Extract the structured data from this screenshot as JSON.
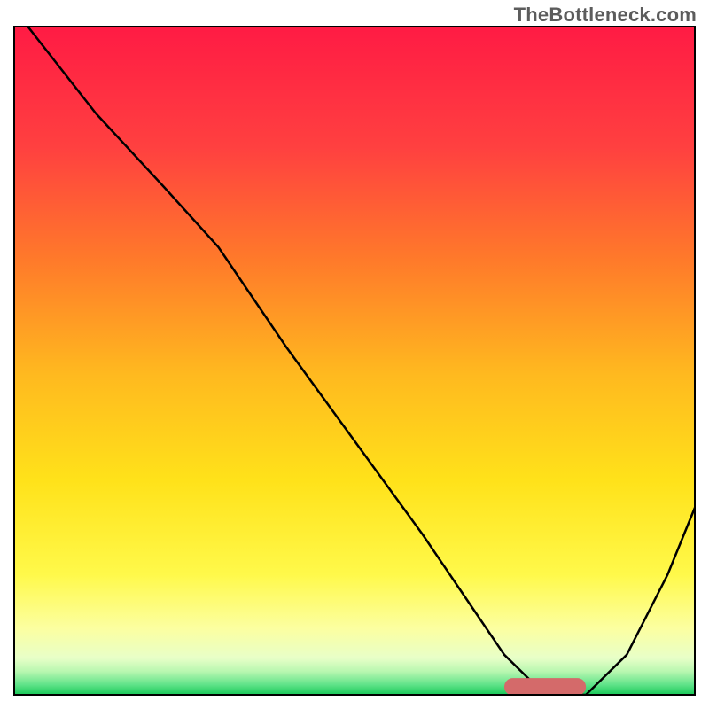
{
  "watermark": "TheBottleneck.com",
  "chart_data": {
    "type": "line",
    "title": "",
    "xlabel": "",
    "ylabel": "",
    "xlim": [
      0,
      100
    ],
    "ylim": [
      0,
      100
    ],
    "grid": false,
    "legend": false,
    "background_gradient_stops": [
      {
        "offset": 0.0,
        "color": "#ff1b44"
      },
      {
        "offset": 0.18,
        "color": "#ff4040"
      },
      {
        "offset": 0.35,
        "color": "#ff7a2a"
      },
      {
        "offset": 0.52,
        "color": "#ffb91f"
      },
      {
        "offset": 0.68,
        "color": "#ffe21a"
      },
      {
        "offset": 0.82,
        "color": "#fff94a"
      },
      {
        "offset": 0.9,
        "color": "#fcffa0"
      },
      {
        "offset": 0.945,
        "color": "#e8ffc8"
      },
      {
        "offset": 0.965,
        "color": "#b8f7b0"
      },
      {
        "offset": 0.985,
        "color": "#5fe389"
      },
      {
        "offset": 1.0,
        "color": "#17c757"
      }
    ],
    "series": [
      {
        "name": "bottleneck-curve",
        "stroke": "#000000",
        "stroke_width": 2.5,
        "x": [
          2,
          12,
          22,
          30,
          40,
          50,
          60,
          68,
          72,
          76,
          80,
          84,
          90,
          96,
          100
        ],
        "y": [
          100,
          87,
          76,
          67,
          52,
          38,
          24,
          12,
          6,
          2,
          0,
          0,
          6,
          18,
          28
        ]
      }
    ],
    "marker": {
      "name": "optimal-range",
      "shape": "capsule",
      "x_center": 78,
      "y_center": 1.2,
      "width": 12,
      "height": 2.6,
      "fill": "#d46a6a"
    },
    "axes": {
      "frame_color": "#000000",
      "frame_width": 2
    }
  }
}
